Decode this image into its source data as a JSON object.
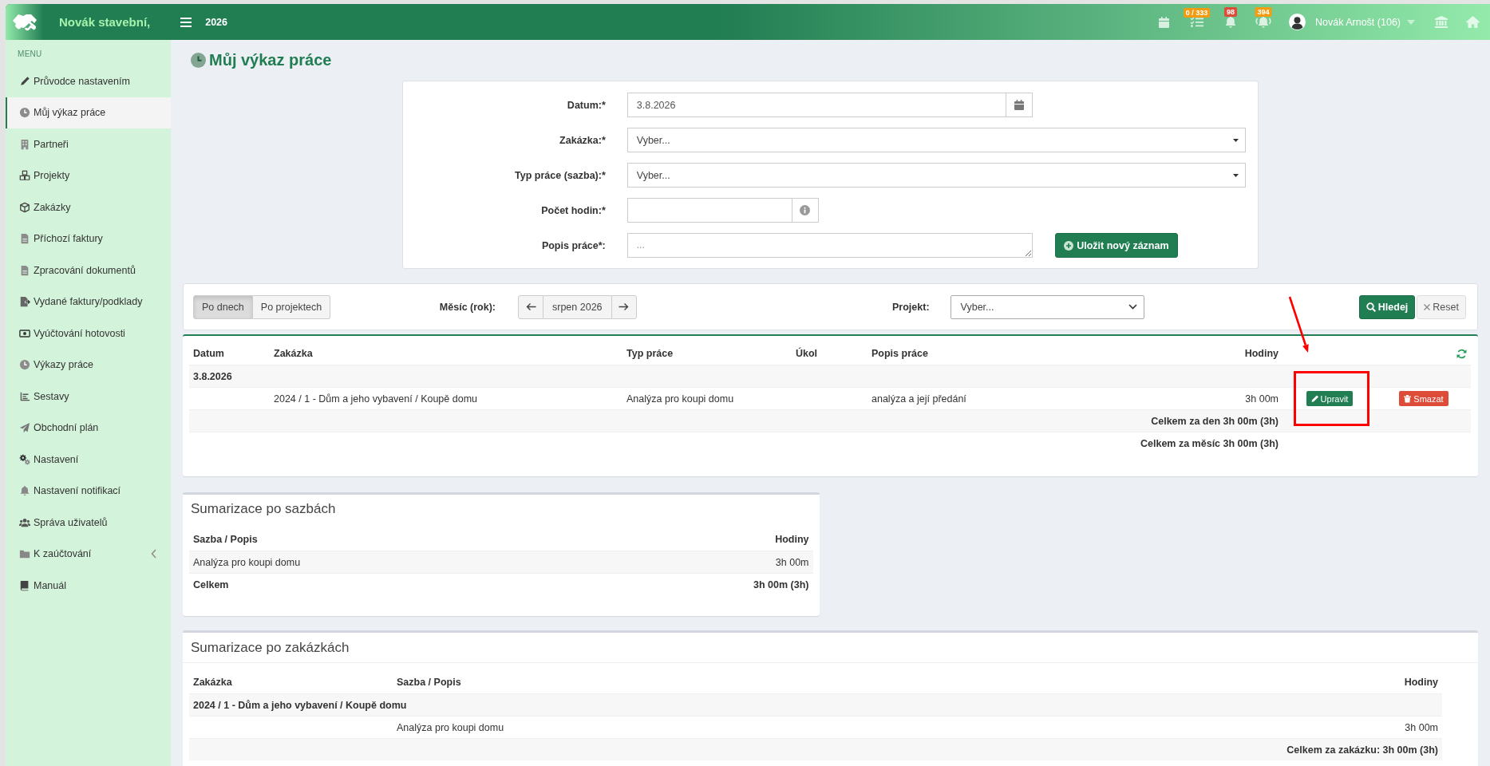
{
  "topbar": {
    "company": "Novák stavební,",
    "year": "2026",
    "notifications": [
      {
        "badge": "0 / 333",
        "color": "#f39c12"
      },
      {
        "badge": "98",
        "color": "#dd4b39"
      },
      {
        "badge": "394",
        "color": "#f39c12"
      }
    ],
    "user": "Novák Arnošt (106)"
  },
  "sidebar": {
    "heading": "MENU",
    "items": [
      {
        "label": "Průvodce nastavením",
        "kind": "link",
        "selected": false
      },
      {
        "label": "Můj výkaz práce",
        "kind": "link",
        "selected": true
      },
      {
        "label": "Partneři",
        "kind": "link",
        "selected": false
      },
      {
        "label": "Projekty",
        "kind": "link",
        "selected": false
      },
      {
        "label": "Zakázky",
        "kind": "link",
        "selected": false
      },
      {
        "label": "Příchozí faktury",
        "kind": "link",
        "selected": false
      },
      {
        "label": "Zpracování dokumentů",
        "kind": "link",
        "selected": false
      },
      {
        "label": "Vydané faktury/podklady",
        "kind": "link",
        "selected": false
      },
      {
        "label": "Vyúčtování hotovosti",
        "kind": "link",
        "selected": false
      },
      {
        "label": "Výkazy práce",
        "kind": "link",
        "selected": false
      },
      {
        "label": "Sestavy",
        "kind": "link",
        "selected": false
      },
      {
        "label": "Obchodní plán",
        "kind": "link",
        "selected": false
      },
      {
        "label": "Nastavení",
        "kind": "link",
        "selected": false
      },
      {
        "label": "Nastavení notifikací",
        "kind": "link",
        "selected": false
      },
      {
        "label": "Správa uživatelů",
        "kind": "link",
        "selected": false
      },
      {
        "label": "K zaúčtování",
        "kind": "group",
        "selected": false,
        "expanded": false
      },
      {
        "label": "Manuál",
        "kind": "link",
        "selected": false
      }
    ]
  },
  "page": {
    "title": "Můj výkaz práce"
  },
  "form": {
    "fields": [
      {
        "label": "Datum:*",
        "kind": "date",
        "value": "3.8.2026"
      },
      {
        "label": "Zakázka:*",
        "kind": "select",
        "value": "Vyber..."
      },
      {
        "label": "Typ práce (sazba):*",
        "kind": "select",
        "value": "Vyber..."
      },
      {
        "label": "Počet hodin:*",
        "kind": "number"
      },
      {
        "label": "Popis práce*:",
        "kind": "textarea",
        "placeholder": "..."
      }
    ],
    "submit": "Uložit nový záznam"
  },
  "filter": {
    "views": [
      {
        "label": "Po dnech",
        "selected": true
      },
      {
        "label": "Po projektech",
        "selected": false
      }
    ],
    "month_label": "Měsíc (rok):",
    "month": "srpen 2026",
    "project_label": "Projekt:",
    "project": "Vyber...",
    "search": "Hledej",
    "reset": "Reset"
  },
  "table": {
    "columns": [
      "Datum",
      "Zakázka",
      "Typ práce",
      "Úkol",
      "Popis práce",
      "Hodiny"
    ],
    "groups": [
      {
        "date": "3.8.2026",
        "rows": [
          {
            "order": "2024 / 1 - Dům a jeho vybavení / Koupě domu",
            "work_type": "Analýza pro koupi domu",
            "description": "analýza a její předání",
            "hours": "3h 00m",
            "actions": [
              {
                "label": "Upravit",
                "kind": "edit",
                "highlighted": true
              },
              {
                "label": "Smazat",
                "kind": "delete",
                "highlighted": false
              }
            ]
          }
        ],
        "total": "Celkem za den 3h 00m (3h)"
      }
    ],
    "month_total": "Celkem za měsíc 3h 00m (3h)"
  },
  "rate_summary": {
    "title": "Sumarizace po sazbách",
    "columns": [
      "Sazba / Popis",
      "Hodiny"
    ],
    "rows": [
      {
        "rate": "Analýza pro koupi domu",
        "hours": "3h 00m"
      }
    ],
    "total": {
      "label": "Celkem",
      "hours": "3h 00m (3h)"
    }
  },
  "order_summary": {
    "title": "Sumarizace po zakázkách",
    "columns": [
      "Zakázka",
      "Sazba / Popis",
      "Hodiny"
    ],
    "groups": [
      {
        "order": "2024 / 1 - Dům a jeho vybavení / Koupě domu",
        "rows": [
          {
            "rate": "Analýza pro koupi domu",
            "hours": "3h 00m"
          }
        ],
        "total": "Celkem za zakázku: 3h 00m (3h)"
      }
    ]
  }
}
